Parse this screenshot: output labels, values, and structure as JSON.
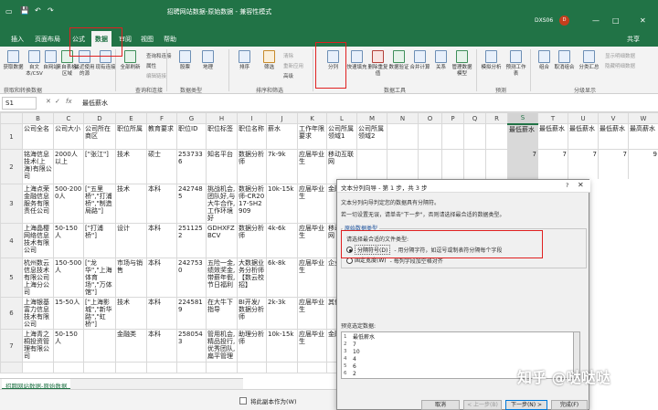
{
  "title": "招聘网站数据-原始数据 - 兼容性模式",
  "user": "DXS06",
  "avatar_text": "D",
  "window_controls": [
    "—",
    "□",
    "✕"
  ],
  "tabs": [
    "插入",
    "页面布局",
    "公式",
    "数据",
    "审阅",
    "视图",
    "帮助"
  ],
  "active_tab": "数据",
  "share_label": "共享",
  "ribbon": {
    "get_data": [
      {
        "label": "获取数据",
        "icon": "get-data-icon"
      },
      {
        "label": "自文本/CSV",
        "icon": "text-csv-icon"
      },
      {
        "label": "自网站",
        "icon": "web-icon"
      },
      {
        "label": "来自表格/区域",
        "icon": "table-range-icon"
      },
      {
        "label": "最近使用的源",
        "icon": "recent-sources-icon"
      },
      {
        "label": "现有连接",
        "icon": "existing-connections-icon"
      }
    ],
    "refresh_all": "全部刷新",
    "queries_conn": [
      "查询和连接",
      "属性",
      "编辑链接"
    ],
    "data_types": [
      {
        "label": "股票",
        "icon": "stocks-icon"
      },
      {
        "label": "地理",
        "icon": "geography-icon"
      }
    ],
    "sort_filter": [
      {
        "label": "排序",
        "icon": "sort-icon"
      },
      {
        "label": "筛选",
        "icon": "filter-icon"
      }
    ],
    "sort_small": [
      "清除",
      "重新应用",
      "高级"
    ],
    "data_tools": [
      {
        "label": "分列",
        "icon": "text-to-columns-icon"
      },
      {
        "label": "快速填充",
        "icon": "flash-fill-icon"
      },
      {
        "label": "删除重复值",
        "icon": "remove-duplicates-icon"
      },
      {
        "label": "数据验证",
        "icon": "data-validation-icon"
      },
      {
        "label": "合并计算",
        "icon": "consolidate-icon"
      },
      {
        "label": "关系",
        "icon": "relationships-icon"
      },
      {
        "label": "管理数据模型",
        "icon": "data-model-icon"
      }
    ],
    "forecast": [
      {
        "label": "模拟分析",
        "icon": "what-if-icon"
      },
      {
        "label": "预测工作表",
        "icon": "forecast-sheet-icon"
      }
    ],
    "outline": [
      {
        "label": "组合",
        "icon": "group-icon"
      },
      {
        "label": "取消组合",
        "icon": "ungroup-icon"
      },
      {
        "label": "分类汇总",
        "icon": "subtotal-icon"
      }
    ],
    "outline_small": [
      "显示明细数据",
      "隐藏明细数据"
    ],
    "group_labels": [
      "获取和转换数据",
      "查询和连接",
      "数据类型",
      "排序和筛选",
      "数据工具",
      "预测",
      "分级显示"
    ]
  },
  "formula_bar": {
    "name_box": "S1",
    "cancel": "✕",
    "enter": "✓",
    "fx": "fx",
    "value": "最低薪水"
  },
  "grid": {
    "columns": [
      "B",
      "C",
      "D",
      "E",
      "F",
      "G",
      "H",
      "I",
      "J",
      "K",
      "L",
      "M",
      "N",
      "O",
      "P",
      "Q",
      "R",
      "S",
      "T",
      "U",
      "V",
      "W",
      "X"
    ],
    "rows": [
      {
        "n": "1",
        "cells": [
          "公司全名",
          "公司大小",
          "公司所在商区",
          "职位所属",
          "教育要求",
          "职位ID",
          "职位标签",
          "职位名称",
          "薪水",
          "工作年限要求",
          "公司所属领域1",
          "公司所属领域2",
          "",
          "",
          "",
          "",
          "",
          "最低薪水",
          "最低薪水",
          "最低薪水",
          "最低薪水",
          "最高薪水",
          "平均薪水"
        ]
      },
      {
        "n": "2",
        "cells": [
          "铭海信息技术(上海)有限公司",
          "2000人以上",
          "[\"张江\"]",
          "技术",
          "硕士",
          "2537336",
          "知名平台",
          "数据分析师",
          "7k-9k",
          "应届毕业生",
          "移动互联网",
          "",
          "",
          "",
          "",
          "",
          "",
          "7",
          "7",
          "7",
          "7",
          "9",
          "8"
        ]
      },
      {
        "n": "3",
        "cells": [
          "上海点荣金融信息服务有限责任公司",
          "500-2000人",
          "[\"五里桥\",\"打浦桥\",\"制造局路\"]",
          "技术",
          "本科",
          "2427485",
          "挑战机会,团队好,与大牛合作,工作环境好",
          "数据分析师-CR2017-SH2909",
          "10k-15k",
          "应届毕业生",
          "金融",
          "",
          "",
          "",
          "",
          "",
          "",
          "",
          "",
          "",
          "",
          "",
          "13"
        ]
      },
      {
        "n": "4",
        "cells": [
          "上海晶樱网络信息技术有限公司",
          "50-150人",
          "[\"打浦桥\"]",
          "设计",
          "本科",
          "2511252",
          "GDHXFZBCV",
          "数据分析师",
          "4k-6k",
          "应届毕业生",
          "移动互联网",
          "",
          "",
          "",
          "",
          "",
          "",
          "",
          "",
          "",
          "",
          "",
          "5"
        ]
      },
      {
        "n": "5",
        "cells": [
          "杭州数云信息技术有限公司上海分公司",
          "150-500人",
          "[\"龙华\",\"上海体育场\",\"万体馆\"]",
          "市场与销售",
          "本科",
          "2427530",
          "五险一金,绩效奖金,带薪年假,节日福利",
          "大数据业务分析师【数云校招】",
          "6k-8k",
          "应届毕业生",
          "企业服务",
          "",
          "",
          "",
          "",
          "",
          "",
          "",
          "",
          "",
          "",
          "",
          "7"
        ]
      },
      {
        "n": "6",
        "cells": [
          "上海银基富力信息技术有限公司",
          "15-50人",
          "[\"上海影城\",\"新华路\",\"虹桥\"]",
          "技术",
          "本科",
          "2245819",
          "在大牛下指导",
          "BI开发/数据分析师",
          "2k-3k",
          "应届毕业生",
          "其他",
          "",
          "",
          "",
          "",
          "",
          "",
          "",
          "",
          "",
          "",
          "",
          "3"
        ]
      },
      {
        "n": "7",
        "cells": [
          "上海青之桐投资管理有限公司",
          "50-150人",
          "",
          "金融类",
          "本科",
          "2580543",
          "管用机会,精品投行,优秀团队,扁平管理",
          "助理分析师",
          "10k-15k",
          "应届毕业生",
          "金融",
          "",
          "",
          "",
          "",
          "",
          "",
          "",
          "",
          "",
          "",
          "",
          "13"
        ]
      }
    ],
    "last_row_partial": [
      "",
      "",
      "",
      "",
      "",
      "",
      "",
      "",
      "",
      "",
      "",
      "",
      "",
      "",
      "",
      "",
      "",
      "",
      "",
      "",
      "",
      "",
      ""
    ]
  },
  "sheet_tab": "招聘网站数据-原始数据",
  "dialog": {
    "title": "文本分列向导 - 第 1 步，共 3 步",
    "help": "?",
    "close": "✕",
    "desc1": "文本分列向导判定您的数据具有分隔符。",
    "desc2": "若一切设置无误，请单击\"下一步\"，否则请选择最合适的数据类型。",
    "orig_type_label": "原始数据类型",
    "choose_label": "请选择最合适的文件类型:",
    "opt1_label": "分隔符号(D)",
    "opt1_desc": "- 用分隔字符，如逗号或制表符分隔每个字段",
    "opt2_label": "固定宽度(W)",
    "opt2_desc": "- 每列字段加空格对齐",
    "preview_label": "预览选定数据:",
    "preview_lines": [
      "最低薪水",
      "7",
      "10",
      "4",
      "6",
      "2"
    ],
    "preview_nums": [
      "1",
      "2",
      "3",
      "4",
      "5",
      "6"
    ],
    "btn_cancel": "取消",
    "btn_back": "< 上一步(B)",
    "btn_next": "下一步(N) >",
    "btn_finish": "完成(F)"
  },
  "status_checkbox": "将此副本作为(W)",
  "watermark": "知乎 @哒哒哒"
}
